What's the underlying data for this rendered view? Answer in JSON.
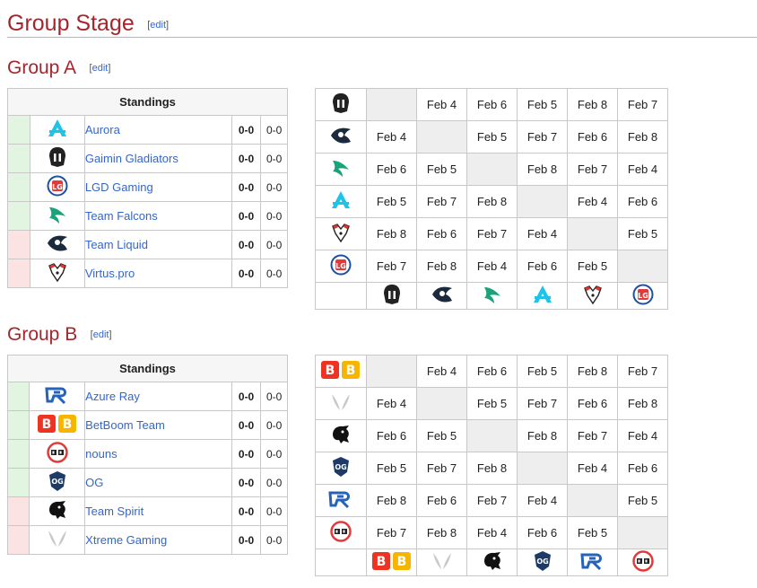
{
  "page": {
    "title": "Group Stage",
    "edit_label": "edit"
  },
  "groups": [
    {
      "title": "Group A",
      "standings_header": "Standings",
      "teams": [
        {
          "name": "Aurora",
          "score": "0-0",
          "maps": "0-0",
          "status": "up",
          "icon": "aurora-icon"
        },
        {
          "name": "Gaimin Gladiators",
          "score": "0-0",
          "maps": "0-0",
          "status": "up",
          "icon": "gaimin-gladiators-icon"
        },
        {
          "name": "LGD Gaming",
          "score": "0-0",
          "maps": "0-0",
          "status": "up",
          "icon": "lgd-gaming-icon"
        },
        {
          "name": "Team Falcons",
          "score": "0-0",
          "maps": "0-0",
          "status": "up",
          "icon": "team-falcons-icon"
        },
        {
          "name": "Team Liquid",
          "score": "0-0",
          "maps": "0-0",
          "status": "down",
          "icon": "team-liquid-icon"
        },
        {
          "name": "Virtus.pro",
          "score": "0-0",
          "maps": "0-0",
          "status": "down",
          "icon": "virtus-pro-icon"
        }
      ],
      "matrix_order": [
        "gaimin-gladiators-icon",
        "team-liquid-icon",
        "team-falcons-icon",
        "aurora-icon",
        "virtus-pro-icon",
        "lgd-gaming-icon"
      ],
      "matrix": [
        [
          "",
          "Feb 4",
          "Feb 6",
          "Feb 5",
          "Feb 8",
          "Feb 7"
        ],
        [
          "Feb 4",
          "",
          "Feb 5",
          "Feb 7",
          "Feb 6",
          "Feb 8"
        ],
        [
          "Feb 6",
          "Feb 5",
          "",
          "Feb 8",
          "Feb 7",
          "Feb 4"
        ],
        [
          "Feb 5",
          "Feb 7",
          "Feb 8",
          "",
          "Feb 4",
          "Feb 6"
        ],
        [
          "Feb 8",
          "Feb 6",
          "Feb 7",
          "Feb 4",
          "",
          "Feb 5"
        ],
        [
          "Feb 7",
          "Feb 8",
          "Feb 4",
          "Feb 6",
          "Feb 5",
          ""
        ]
      ]
    },
    {
      "title": "Group B",
      "standings_header": "Standings",
      "teams": [
        {
          "name": "Azure Ray",
          "score": "0-0",
          "maps": "0-0",
          "status": "up",
          "icon": "azure-ray-icon"
        },
        {
          "name": "BetBoom Team",
          "score": "0-0",
          "maps": "0-0",
          "status": "up",
          "icon": "betboom-team-icon"
        },
        {
          "name": "nouns",
          "score": "0-0",
          "maps": "0-0",
          "status": "up",
          "icon": "nouns-icon"
        },
        {
          "name": "OG",
          "score": "0-0",
          "maps": "0-0",
          "status": "up",
          "icon": "og-icon"
        },
        {
          "name": "Team Spirit",
          "score": "0-0",
          "maps": "0-0",
          "status": "down",
          "icon": "team-spirit-icon"
        },
        {
          "name": "Xtreme Gaming",
          "score": "0-0",
          "maps": "0-0",
          "status": "down",
          "icon": "xtreme-gaming-icon"
        }
      ],
      "matrix_order": [
        "betboom-team-icon",
        "xtreme-gaming-icon",
        "team-spirit-icon",
        "og-icon",
        "azure-ray-icon",
        "nouns-icon"
      ],
      "matrix": [
        [
          "",
          "Feb 4",
          "Feb 6",
          "Feb 5",
          "Feb 8",
          "Feb 7"
        ],
        [
          "Feb 4",
          "",
          "Feb 5",
          "Feb 7",
          "Feb 6",
          "Feb 8"
        ],
        [
          "Feb 6",
          "Feb 5",
          "",
          "Feb 8",
          "Feb 7",
          "Feb 4"
        ],
        [
          "Feb 5",
          "Feb 7",
          "Feb 8",
          "",
          "Feb 4",
          "Feb 6"
        ],
        [
          "Feb 8",
          "Feb 6",
          "Feb 7",
          "Feb 4",
          "",
          "Feb 5"
        ],
        [
          "Feb 7",
          "Feb 8",
          "Feb 4",
          "Feb 6",
          "Feb 5",
          ""
        ]
      ]
    }
  ],
  "colors": {
    "heading": "#a4262c",
    "link": "#3366cc",
    "advance": "#e1f5e1",
    "eliminated": "#fbe3e3",
    "self_cell": "#eeeeee"
  }
}
